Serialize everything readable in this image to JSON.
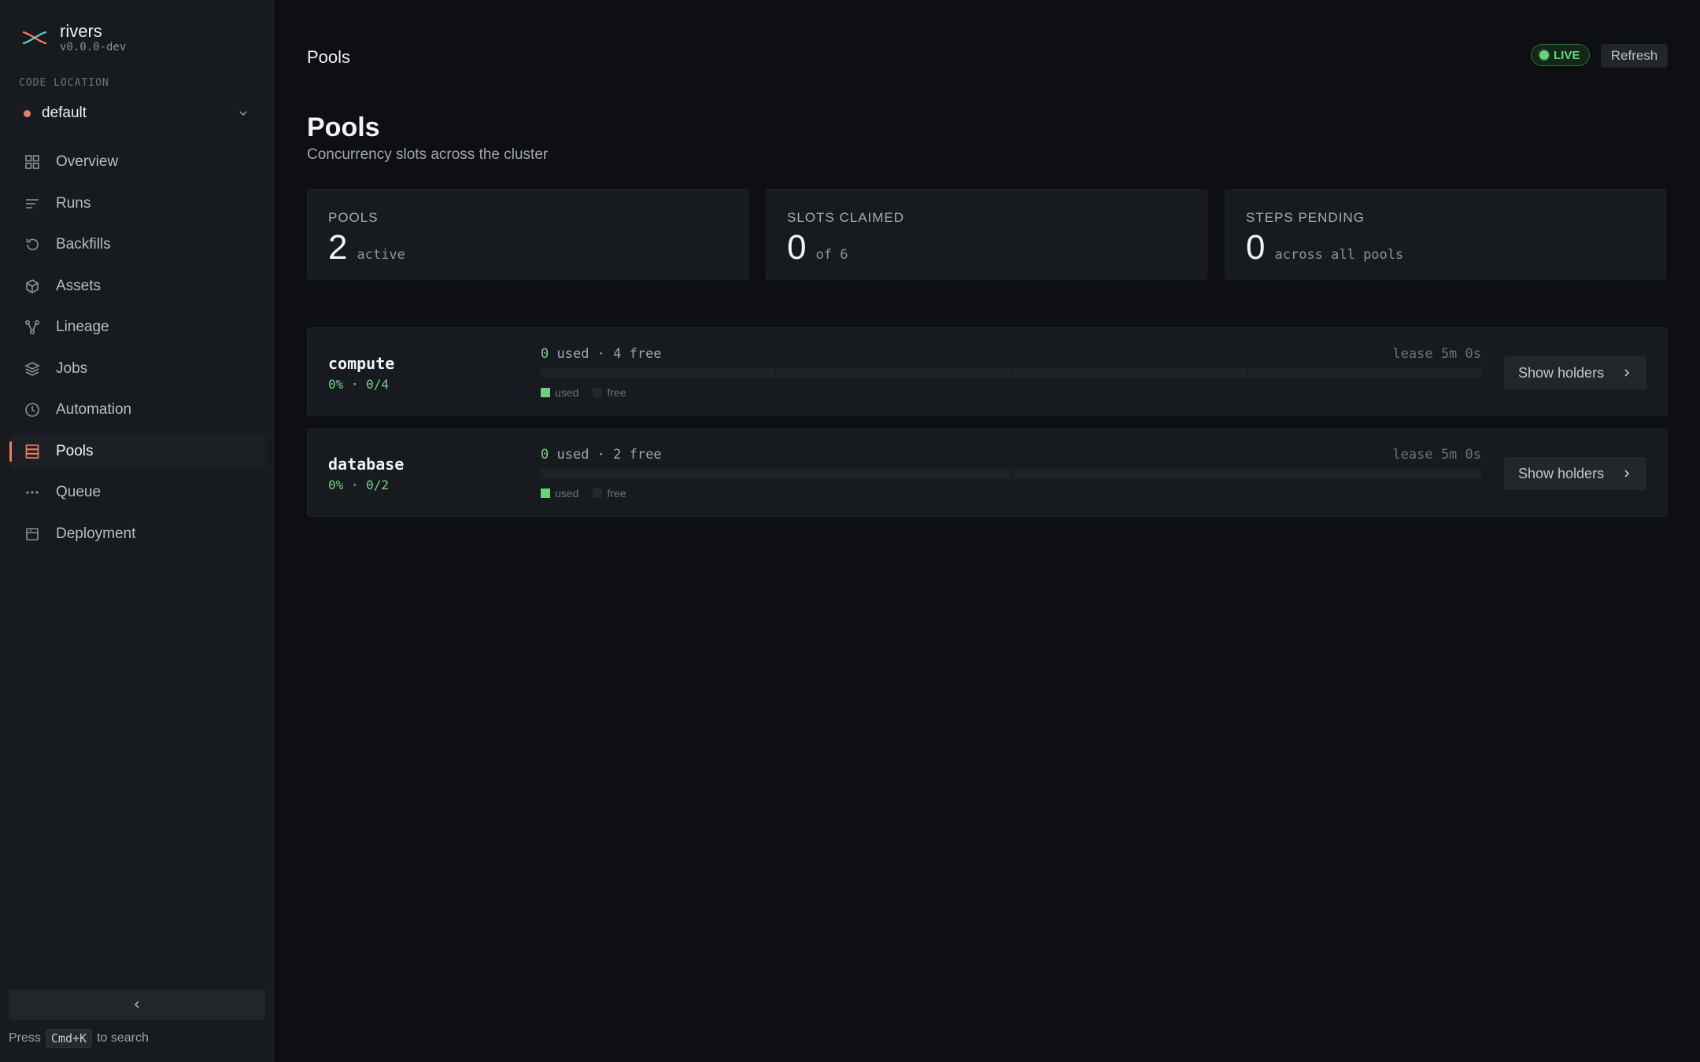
{
  "app": {
    "name": "rivers",
    "version": "v0.0.0-dev"
  },
  "sidebar": {
    "section_label": "CODE LOCATION",
    "location": {
      "name": "default",
      "status_color": "#f07a66"
    },
    "items": [
      {
        "label": "Overview",
        "icon": "grid-icon"
      },
      {
        "label": "Runs",
        "icon": "lines-icon"
      },
      {
        "label": "Backfills",
        "icon": "history-icon"
      },
      {
        "label": "Assets",
        "icon": "cube-icon"
      },
      {
        "label": "Lineage",
        "icon": "graph-icon"
      },
      {
        "label": "Jobs",
        "icon": "layers-icon"
      },
      {
        "label": "Automation",
        "icon": "clock-icon"
      },
      {
        "label": "Pools",
        "icon": "database-icon",
        "active": true
      },
      {
        "label": "Queue",
        "icon": "ellipsis-icon"
      },
      {
        "label": "Deployment",
        "icon": "box-icon"
      }
    ],
    "search_hint": {
      "prefix": "Press",
      "key": "Cmd+K",
      "suffix": "to search"
    }
  },
  "topbar": {
    "title": "Pools",
    "live_label": "LIVE",
    "refresh_label": "Refresh"
  },
  "page": {
    "title": "Pools",
    "subtitle": "Concurrency slots across the cluster"
  },
  "stats": [
    {
      "label": "POOLS",
      "value": "2",
      "unit": "active"
    },
    {
      "label": "SLOTS CLAIMED",
      "value": "0",
      "unit": "of 6"
    },
    {
      "label": "STEPS PENDING",
      "value": "0",
      "unit": "across all pools"
    }
  ],
  "pools": [
    {
      "name": "compute",
      "pct": "0% · 0/4",
      "used": "0",
      "usage_rest": " used · 4 free",
      "lease": "lease 5m 0s",
      "slots_used": 0,
      "slots_total": 4,
      "legend_used": "used",
      "legend_free": "free",
      "button": "Show holders"
    },
    {
      "name": "database",
      "pct": "0% · 0/2",
      "used": "0",
      "usage_rest": " used · 2 free",
      "lease": "lease 5m 0s",
      "slots_used": 0,
      "slots_total": 2,
      "legend_used": "used",
      "legend_free": "free",
      "button": "Show holders"
    }
  ],
  "colors": {
    "accent": "#f07a66",
    "success": "#6bd27b"
  }
}
